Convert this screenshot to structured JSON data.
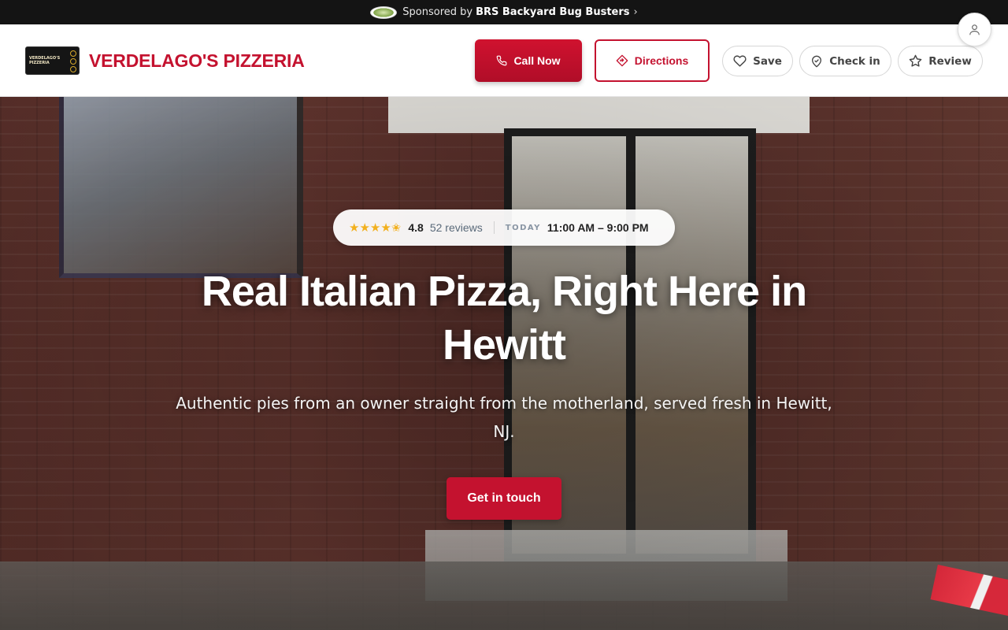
{
  "sponsor": {
    "prefix": "Sponsored by",
    "name": "BRS Backyard Bug Busters",
    "chevron": "›",
    "logo_icon": "sponsor-logo-icon"
  },
  "brand": {
    "name": "VERDELAGO'S PIZZERIA",
    "logo_text": "VERDELAGO'S PIZZERIA",
    "color": "#c4122f"
  },
  "header_actions": {
    "call": {
      "label": "Call Now",
      "icon": "phone-icon"
    },
    "directions": {
      "label": "Directions",
      "icon": "directions-icon"
    },
    "save": {
      "label": "Save",
      "icon": "heart-icon"
    },
    "checkin": {
      "label": "Check in",
      "icon": "map-pin-icon"
    },
    "review": {
      "label": "Review",
      "icon": "star-icon"
    },
    "profile": {
      "icon": "user-icon"
    }
  },
  "rating": {
    "stars": "★★★★",
    "half_star": "✬",
    "value": "4.8",
    "reviews": "52 reviews",
    "today_label": "TODAY",
    "hours": "11:00 AM – 9:00 PM"
  },
  "hero": {
    "headline": "Real Italian Pizza, Right Here in Hewitt",
    "subline": "Authentic pies from an owner straight from the motherland, served fresh in Hewitt, NJ.",
    "cta": "Get in touch"
  },
  "colors": {
    "accent": "#c4122f",
    "sponsor_bg": "#141414",
    "star": "#f2b01e"
  }
}
